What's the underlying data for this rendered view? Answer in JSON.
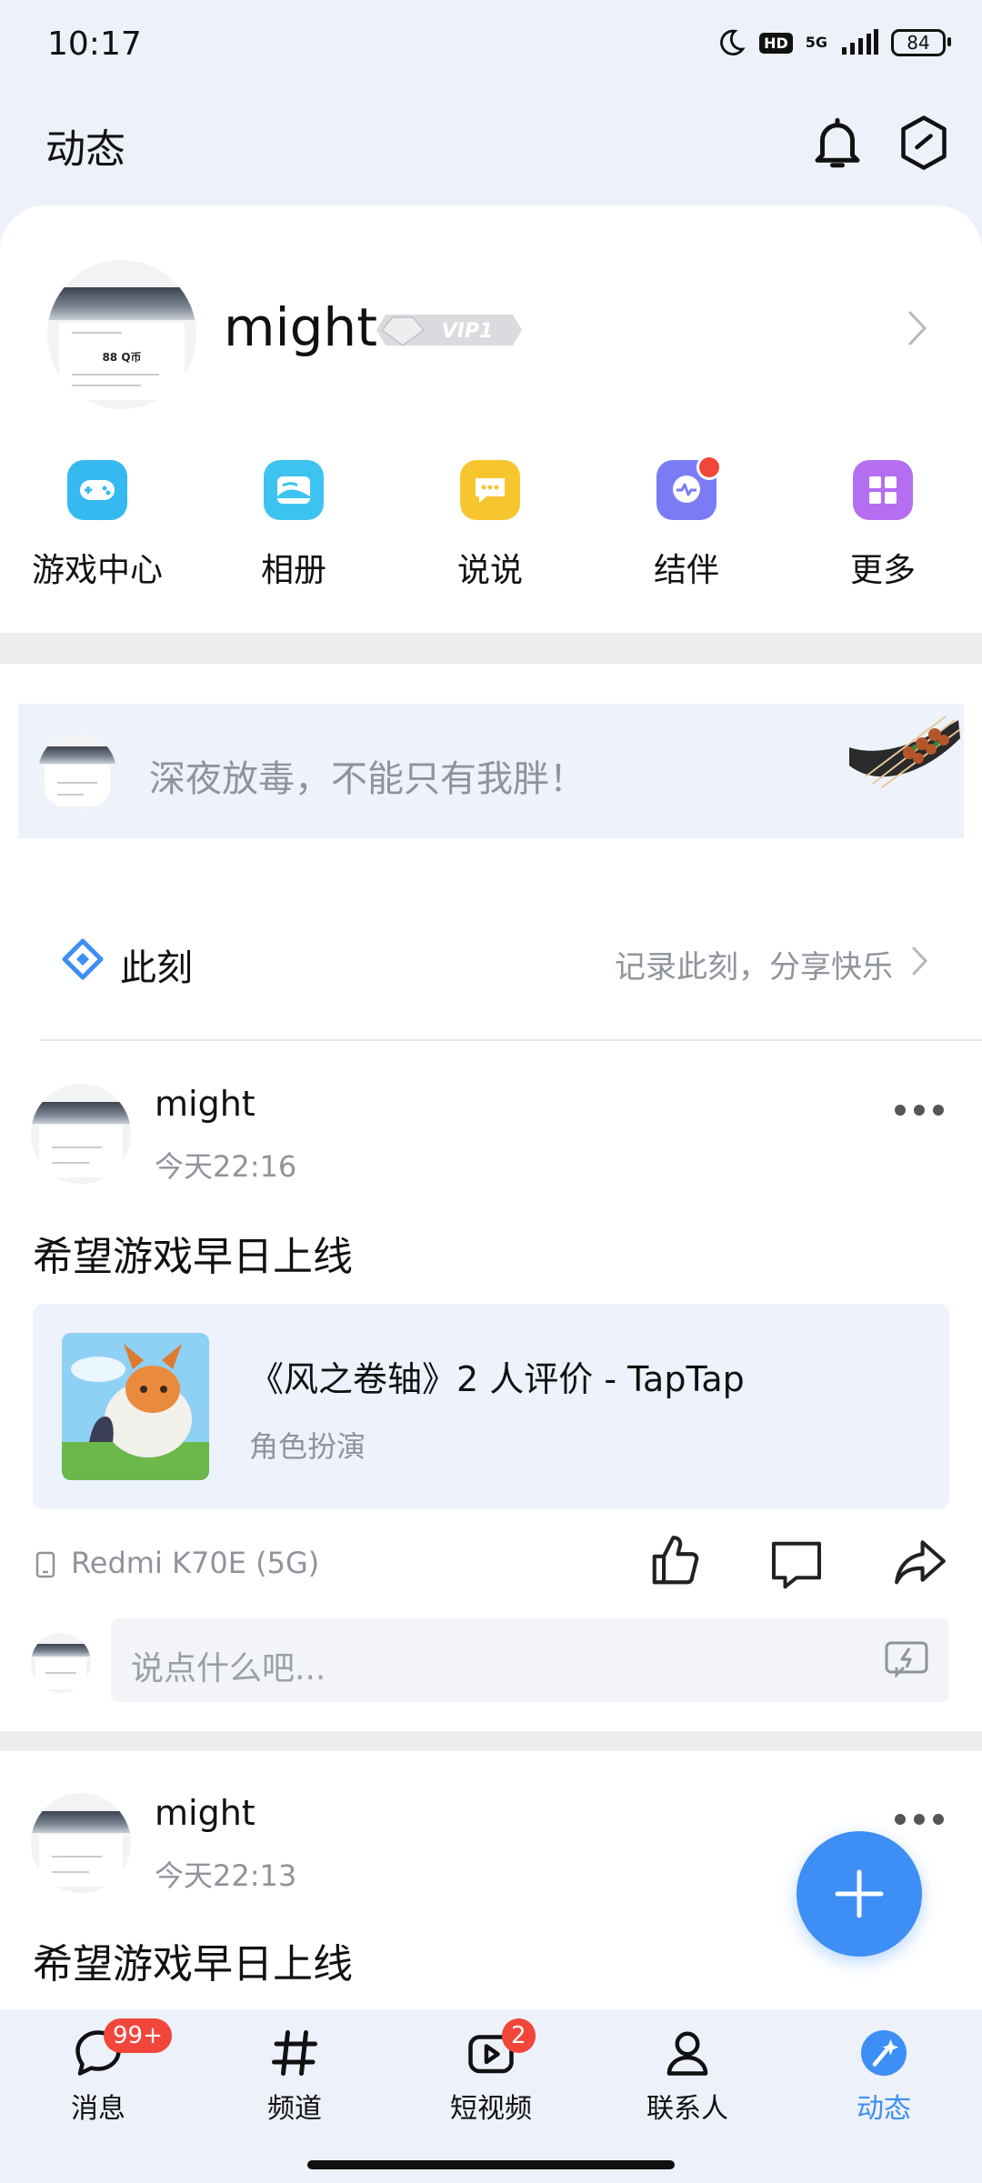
{
  "status_bar": {
    "time": "10:17",
    "hd": "HD",
    "network": "5G",
    "battery": "84"
  },
  "header": {
    "title": "动态"
  },
  "profile": {
    "name": "might",
    "vip": "VIP1"
  },
  "quick_actions": [
    {
      "label": "游戏中心",
      "icon": "gamepad-icon",
      "color": "#36b9f0"
    },
    {
      "label": "相册",
      "icon": "album-icon",
      "color": "#3dc3f0"
    },
    {
      "label": "说说",
      "icon": "chat-bubble-icon",
      "color": "#f7c62f"
    },
    {
      "label": "结伴",
      "icon": "companion-icon",
      "color": "#7a7cf6"
    },
    {
      "label": "更多",
      "icon": "grid-icon",
      "color": "#b66ef0"
    }
  ],
  "mood": {
    "text": "深夜放毒，不能只有我胖！"
  },
  "moment": {
    "title": "此刻",
    "hint": "记录此刻，分享快乐"
  },
  "posts": [
    {
      "name": "might",
      "time": "今天22:16",
      "body": "希望游戏早日上线",
      "link": {
        "title": "《风之卷轴》2 人评价 - TapTap",
        "subtitle": "角色扮演"
      },
      "device": "Redmi K70E (5G)",
      "comment_placeholder": "说点什么吧..."
    },
    {
      "name": "might",
      "time": "今天22:13",
      "body": "希望游戏早日上线"
    }
  ],
  "avatar_text": {
    "title": "Q币充值成功通知",
    "amount": "88 Q币"
  },
  "bottom_nav": [
    {
      "label": "消息",
      "badge": "99+"
    },
    {
      "label": "频道",
      "badge": ""
    },
    {
      "label": "短视频",
      "badge": "2"
    },
    {
      "label": "联系人",
      "badge": ""
    },
    {
      "label": "动态",
      "badge": "",
      "active": true
    }
  ],
  "colors": {
    "accent": "#3d8ef5",
    "badge": "#f2463b",
    "active_tab": "#3d8ef5"
  }
}
